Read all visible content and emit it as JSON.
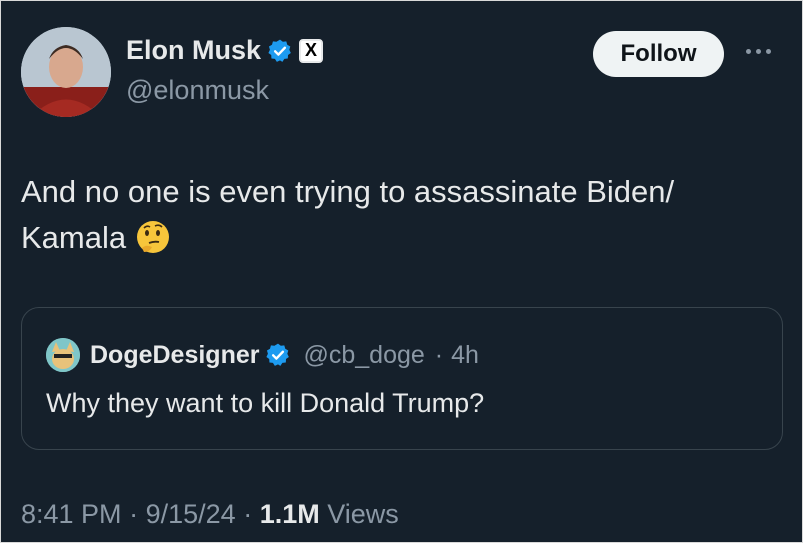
{
  "author": {
    "display_name": "Elon Musk",
    "handle": "@elonmusk",
    "verified": true,
    "affiliate_badge": "X"
  },
  "actions": {
    "follow_label": "Follow",
    "more_icon": "more-horizontal-icon"
  },
  "tweet": {
    "text": "And no one is even trying to assassinate Biden/ Kamala",
    "emoji": "thinking-face-emoji"
  },
  "quoted_tweet": {
    "display_name": "DogeDesigner",
    "handle": "@cb_doge",
    "separator": "·",
    "time": "4h",
    "text": "Why they want to kill Donald Trump?"
  },
  "meta": {
    "time": "8:41 PM",
    "sep1": "·",
    "date": "9/15/24",
    "sep2": "·",
    "views_count": "1.1M",
    "views_label": "Views"
  },
  "colors": {
    "background": "#15202b",
    "text": "#e7e9ea",
    "muted": "#8b98a5",
    "verified_blue": "#1d9bf0",
    "border": "#38444d"
  }
}
